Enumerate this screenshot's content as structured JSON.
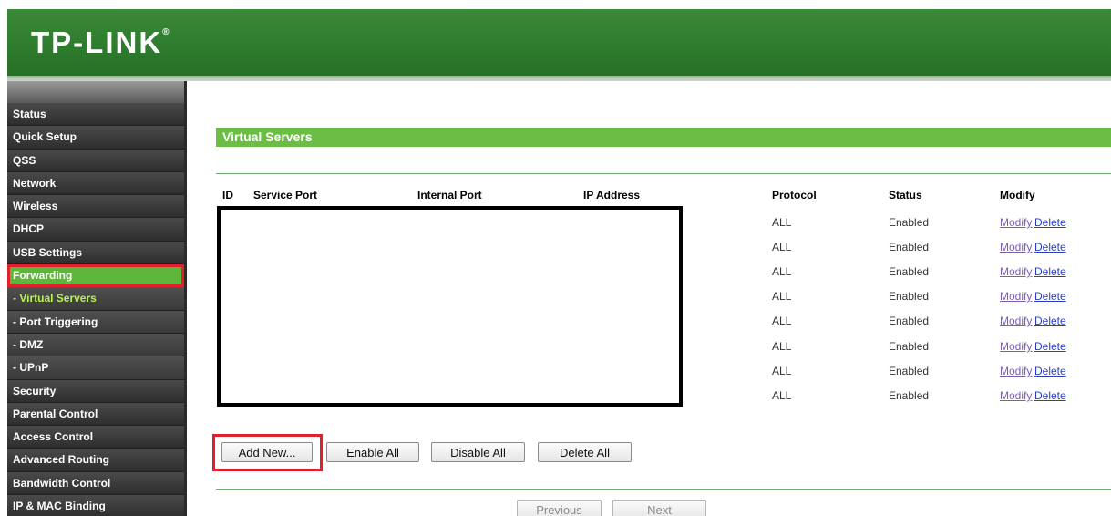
{
  "header": {
    "logo": "TP-LINK",
    "logo_mark": "®"
  },
  "sidebar": {
    "items": [
      {
        "label": "Status",
        "type": "main"
      },
      {
        "label": "Quick Setup",
        "type": "main"
      },
      {
        "label": "QSS",
        "type": "main"
      },
      {
        "label": "Network",
        "type": "main"
      },
      {
        "label": "Wireless",
        "type": "main"
      },
      {
        "label": "DHCP",
        "type": "main"
      },
      {
        "label": "USB Settings",
        "type": "main"
      },
      {
        "label": "Forwarding",
        "type": "active"
      },
      {
        "label": "- Virtual Servers",
        "type": "sub-active"
      },
      {
        "label": "- Port Triggering",
        "type": "sub"
      },
      {
        "label": "- DMZ",
        "type": "sub"
      },
      {
        "label": "- UPnP",
        "type": "sub"
      },
      {
        "label": "Security",
        "type": "main"
      },
      {
        "label": "Parental Control",
        "type": "main"
      },
      {
        "label": "Access Control",
        "type": "main"
      },
      {
        "label": "Advanced Routing",
        "type": "main"
      },
      {
        "label": "Bandwidth Control",
        "type": "main"
      },
      {
        "label": "IP & MAC Binding",
        "type": "main"
      }
    ]
  },
  "main": {
    "title": "Virtual Servers",
    "table": {
      "headers": {
        "id": "ID",
        "service_port": "Service Port",
        "internal_port": "Internal Port",
        "ip_address": "IP Address",
        "protocol": "Protocol",
        "status": "Status",
        "modify": "Modify"
      },
      "rows": [
        {
          "protocol": "ALL",
          "status": "Enabled",
          "modify": "Modify",
          "delete": "Delete"
        },
        {
          "protocol": "ALL",
          "status": "Enabled",
          "modify": "Modify",
          "delete": "Delete"
        },
        {
          "protocol": "ALL",
          "status": "Enabled",
          "modify": "Modify",
          "delete": "Delete"
        },
        {
          "protocol": "ALL",
          "status": "Enabled",
          "modify": "Modify",
          "delete": "Delete"
        },
        {
          "protocol": "ALL",
          "status": "Enabled",
          "modify": "Modify",
          "delete": "Delete"
        },
        {
          "protocol": "ALL",
          "status": "Enabled",
          "modify": "Modify",
          "delete": "Delete"
        },
        {
          "protocol": "ALL",
          "status": "Enabled",
          "modify": "Modify",
          "delete": "Delete"
        },
        {
          "protocol": "ALL",
          "status": "Enabled",
          "modify": "Modify",
          "delete": "Delete"
        }
      ]
    },
    "buttons": {
      "add_new": "Add New...",
      "enable_all": "Enable All",
      "disable_all": "Disable All",
      "delete_all": "Delete All",
      "previous": "Previous",
      "next": "Next"
    }
  },
  "colors": {
    "header_green": "#2d7b2d",
    "accent_green": "#6cbd45",
    "highlight_red": "#e0202a"
  }
}
